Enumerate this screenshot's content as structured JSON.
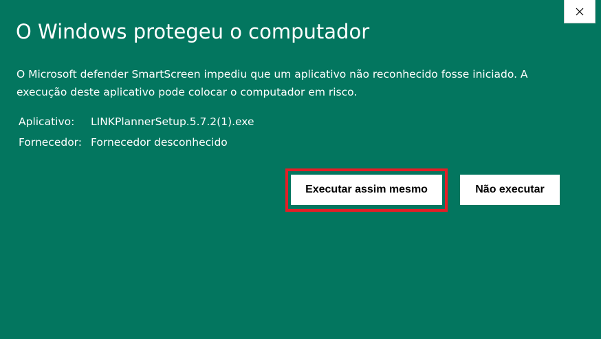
{
  "dialog": {
    "title": "O Windows protegeu o computador",
    "description": "O Microsoft defender SmartScreen impediu que um aplicativo não reconhecido fosse iniciado. A execução deste aplicativo pode colocar o computador em risco.",
    "details": [
      {
        "label": "Aplicativo:",
        "value": "LINKPlannerSetup.5.7.2(1).exe"
      },
      {
        "label": "Fornecedor:",
        "value": "Fornecedor desconhecido"
      }
    ],
    "buttons": {
      "run_anyway": "Executar assim mesmo",
      "dont_run": "Não executar"
    },
    "colors": {
      "background": "#03765f",
      "highlight": "#e41e26",
      "button": "#ffffff"
    },
    "icons": {
      "close": "close-icon"
    }
  }
}
